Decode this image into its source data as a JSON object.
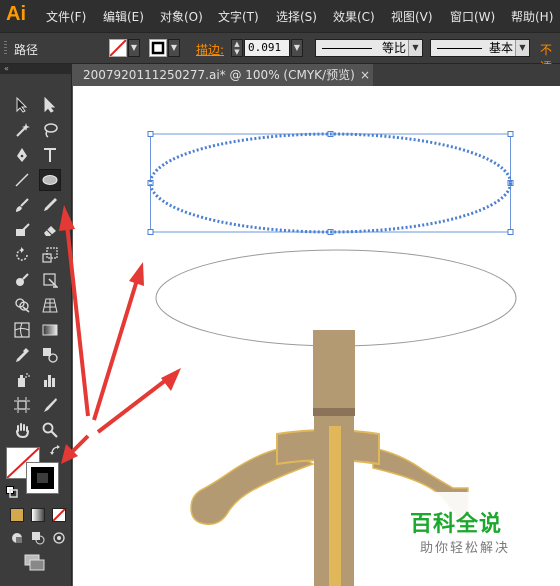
{
  "app": {
    "logo": "Ai"
  },
  "menu": [
    "文件(F)",
    "编辑(E)",
    "对象(O)",
    "文字(T)",
    "选择(S)",
    "效果(C)",
    "视图(V)",
    "窗口(W)",
    "帮助(H)"
  ],
  "control": {
    "selection_label": "路径",
    "stroke_label": "描边:",
    "stroke_value": "0.091",
    "variable_width_label": "等比",
    "brush_label": "基本",
    "opacity_label": "不透"
  },
  "document_tab": {
    "title": "2007920111250277.ai* @ 100% (CMYK/预览)",
    "close": "×"
  },
  "toolbox": {
    "collapse_glyph": "«"
  },
  "watermark": {
    "brand": "百科全说",
    "slogan": "助你轻松解决"
  },
  "colors": {
    "ui_dark": "#2f2f2f",
    "panel": "#3c3c3c",
    "accent_orange": "#ff8c00",
    "selection_blue": "#4a7fd4",
    "arrow_red": "#e53935",
    "table_tan": "#b39a73",
    "table_gold": "#e0b85a",
    "watermark_green": "#1ca72d"
  }
}
